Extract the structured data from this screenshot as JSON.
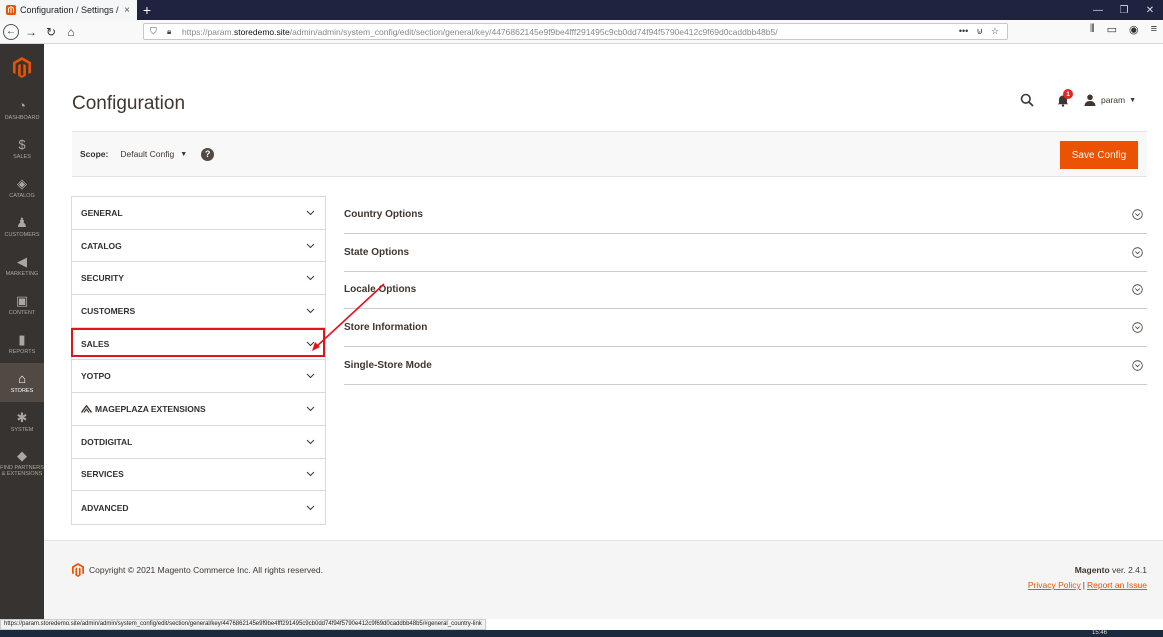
{
  "browser": {
    "tab_title": "Configuration / Settings / Stores",
    "tab_close": "×",
    "new_tab": "+",
    "url_prefix": "https://param.",
    "url_domain": "storedemo.site",
    "url_path": "/admin/admin/system_config/edit/section/general/key/4476862145e9f9be4fff291495c9cb0dd74f94f5790e412c9f69d0caddbb48b5/",
    "status_url": "https://param.storedemo.site/admin/admin/system_config/edit/section/general/key/4476862145e9f9be4fff291495c9cb0dd74f94f5790e412c9f69d0caddbb48b5/#general_country-link",
    "clock": "15:46"
  },
  "sidebar": {
    "items": [
      {
        "label": "DASHBOARD",
        "icon": "dashboard-icon",
        "glyph": "◔"
      },
      {
        "label": "SALES",
        "icon": "dollar-icon",
        "glyph": "$"
      },
      {
        "label": "CATALOG",
        "icon": "cube-icon",
        "glyph": "◈"
      },
      {
        "label": "CUSTOMERS",
        "icon": "person-icon",
        "glyph": "♟"
      },
      {
        "label": "MARKETING",
        "icon": "megaphone-icon",
        "glyph": "◀"
      },
      {
        "label": "CONTENT",
        "icon": "content-icon",
        "glyph": "▣"
      },
      {
        "label": "REPORTS",
        "icon": "bar-chart-icon",
        "glyph": "▮"
      },
      {
        "label": "STORES",
        "icon": "store-icon",
        "glyph": "⌂"
      },
      {
        "label": "SYSTEM",
        "icon": "gear-icon",
        "glyph": "✱"
      },
      {
        "label": "FIND PARTNERS & EXTENSIONS",
        "icon": "box-icon",
        "glyph": "◆"
      }
    ]
  },
  "header": {
    "title": "Configuration",
    "notification_count": "1",
    "username": "param"
  },
  "scope": {
    "label": "Scope:",
    "value": "Default Config",
    "help": "?",
    "save_label": "Save Config"
  },
  "tabs": [
    {
      "label": "GENERAL"
    },
    {
      "label": "CATALOG"
    },
    {
      "label": "SECURITY"
    },
    {
      "label": "CUSTOMERS"
    },
    {
      "label": "SALES"
    },
    {
      "label": "YOTPO"
    },
    {
      "label": "MAGEPLAZA EXTENSIONS"
    },
    {
      "label": "DOTDIGITAL"
    },
    {
      "label": "SERVICES"
    },
    {
      "label": "ADVANCED"
    }
  ],
  "sections": [
    {
      "title": "Country Options"
    },
    {
      "title": "State Options"
    },
    {
      "title": "Locale Options"
    },
    {
      "title": "Store Information"
    },
    {
      "title": "Single-Store Mode"
    }
  ],
  "footer": {
    "copyright": "Copyright © 2021 Magento Commerce Inc. All rights reserved.",
    "brand": "Magento",
    "version": " ver. 2.4.1",
    "privacy_policy": "Privacy Policy",
    "separator": "|",
    "report_issue": "Report an Issue"
  },
  "colors": {
    "accent": "#eb5202",
    "sidebar_bg": "#373330",
    "annotation_red": "#e1141d"
  }
}
